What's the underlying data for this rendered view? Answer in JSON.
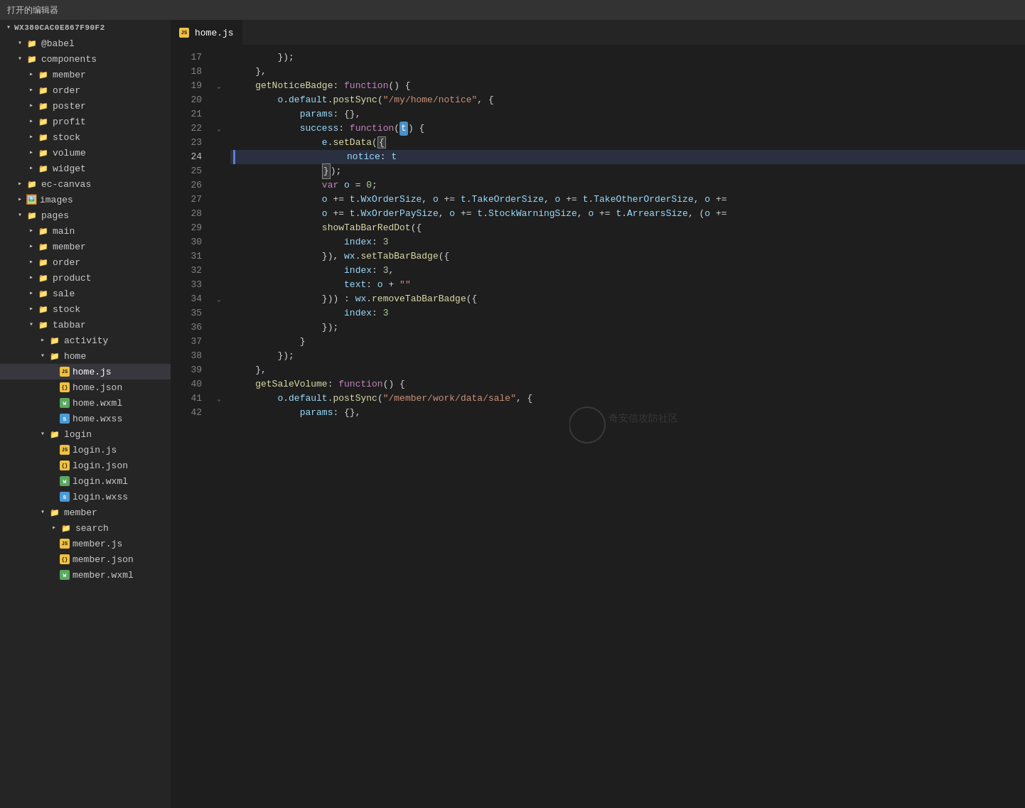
{
  "titleBar": {
    "label": "打开的编辑器"
  },
  "sidebar": {
    "rootLabel": "WX380CAC0E867F90F2",
    "items": [
      {
        "id": "babel",
        "label": "@babel",
        "type": "folder",
        "indent": 1,
        "open": true
      },
      {
        "id": "components",
        "label": "components",
        "type": "folder",
        "indent": 1,
        "open": true
      },
      {
        "id": "member-folder",
        "label": "member",
        "type": "folder",
        "indent": 2,
        "open": false
      },
      {
        "id": "order-folder",
        "label": "order",
        "type": "folder",
        "indent": 2,
        "open": false
      },
      {
        "id": "poster",
        "label": "poster",
        "type": "folder",
        "indent": 2,
        "open": false
      },
      {
        "id": "profit",
        "label": "profit",
        "type": "folder",
        "indent": 2,
        "open": false
      },
      {
        "id": "stock",
        "label": "stock",
        "type": "folder",
        "indent": 2,
        "open": false
      },
      {
        "id": "volume",
        "label": "volume",
        "type": "folder",
        "indent": 2,
        "open": false
      },
      {
        "id": "widget",
        "label": "widget",
        "type": "folder",
        "indent": 2,
        "open": false
      },
      {
        "id": "ec-canvas",
        "label": "ec-canvas",
        "type": "folder",
        "indent": 1,
        "open": false
      },
      {
        "id": "images",
        "label": "images",
        "type": "folder-img",
        "indent": 1,
        "open": false
      },
      {
        "id": "pages",
        "label": "pages",
        "type": "folder",
        "indent": 1,
        "open": true
      },
      {
        "id": "main-folder",
        "label": "main",
        "type": "folder",
        "indent": 2,
        "open": false
      },
      {
        "id": "member-pages",
        "label": "member",
        "type": "folder",
        "indent": 2,
        "open": false
      },
      {
        "id": "order-pages",
        "label": "order",
        "type": "folder",
        "indent": 2,
        "open": false
      },
      {
        "id": "product",
        "label": "product",
        "type": "folder",
        "indent": 2,
        "open": false
      },
      {
        "id": "sale",
        "label": "sale",
        "type": "folder",
        "indent": 2,
        "open": false
      },
      {
        "id": "stock-pages",
        "label": "stock",
        "type": "folder",
        "indent": 2,
        "open": false
      },
      {
        "id": "tabbar",
        "label": "tabbar",
        "type": "folder",
        "indent": 2,
        "open": true
      },
      {
        "id": "activity",
        "label": "activity",
        "type": "folder",
        "indent": 3,
        "open": false
      },
      {
        "id": "home-folder",
        "label": "home",
        "type": "folder",
        "indent": 3,
        "open": true
      },
      {
        "id": "home-js",
        "label": "home.js",
        "type": "js",
        "indent": 4,
        "active": true
      },
      {
        "id": "home-json",
        "label": "home.json",
        "type": "json",
        "indent": 4
      },
      {
        "id": "home-wxml",
        "label": "home.wxml",
        "type": "wxml",
        "indent": 4
      },
      {
        "id": "home-wxss",
        "label": "home.wxss",
        "type": "wxss",
        "indent": 4
      },
      {
        "id": "login-folder",
        "label": "login",
        "type": "folder",
        "indent": 3,
        "open": true
      },
      {
        "id": "login-js",
        "label": "login.js",
        "type": "js",
        "indent": 4
      },
      {
        "id": "login-json",
        "label": "login.json",
        "type": "json",
        "indent": 4
      },
      {
        "id": "login-wxml",
        "label": "login.wxml",
        "type": "wxml",
        "indent": 4
      },
      {
        "id": "login-wxss",
        "label": "login.wxss",
        "type": "wxss",
        "indent": 4
      },
      {
        "id": "member-tabbar",
        "label": "member",
        "type": "folder",
        "indent": 3,
        "open": false
      },
      {
        "id": "search-folder",
        "label": "search",
        "type": "folder",
        "indent": 4,
        "open": false
      },
      {
        "id": "member-js",
        "label": "member.js",
        "type": "js",
        "indent": 4
      },
      {
        "id": "member-json",
        "label": "member.json",
        "type": "json",
        "indent": 4
      },
      {
        "id": "member-wxml",
        "label": "member.wxml",
        "type": "wxml",
        "indent": 4
      }
    ]
  },
  "editor": {
    "filename": "home.js",
    "lines": [
      {
        "num": 17,
        "fold": false,
        "content": "        });"
      },
      {
        "num": 18,
        "fold": false,
        "content": "    },"
      },
      {
        "num": 19,
        "fold": true,
        "content": "    getNoticeBadge: function() {"
      },
      {
        "num": 20,
        "fold": false,
        "content": "        o.default.postSync(\"/my/home/notice\", {"
      },
      {
        "num": 21,
        "fold": false,
        "content": "            params: {},"
      },
      {
        "num": 22,
        "fold": true,
        "content": "            success: function(t) {"
      },
      {
        "num": 23,
        "fold": false,
        "content": "                e.setData({"
      },
      {
        "num": 24,
        "fold": false,
        "content": "                    notice: t",
        "highlight": true
      },
      {
        "num": 25,
        "fold": false,
        "content": "                });"
      },
      {
        "num": 26,
        "fold": false,
        "content": "                var o = 0;"
      },
      {
        "num": 27,
        "fold": false,
        "content": "                o += t.WxOrderSize, o += t.TakeOrderSize, o += t.TakeOtherOrderSize, o +="
      },
      {
        "num": 28,
        "fold": false,
        "content": "                o += t.WxOrderPaySize, o += t.StockWarningSize, o += t.ArrearsSize, (o +="
      },
      {
        "num": 29,
        "fold": false,
        "content": "                showTabBarRedDot({"
      },
      {
        "num": 30,
        "fold": false,
        "content": "                    index: 3"
      },
      {
        "num": 31,
        "fold": false,
        "content": "                }), wx.setTabBarBadge({"
      },
      {
        "num": 32,
        "fold": false,
        "content": "                    index: 3,"
      },
      {
        "num": 33,
        "fold": false,
        "content": "                    text: o + \"\""
      },
      {
        "num": 34,
        "fold": true,
        "content": "                })) : wx.removeTabBarBadge({"
      },
      {
        "num": 35,
        "fold": false,
        "content": "                    index: 3"
      },
      {
        "num": 36,
        "fold": false,
        "content": "                });"
      },
      {
        "num": 37,
        "fold": false,
        "content": "            }"
      },
      {
        "num": 38,
        "fold": false,
        "content": "        });"
      },
      {
        "num": 39,
        "fold": false,
        "content": "    },"
      },
      {
        "num": 40,
        "fold": false,
        "content": "    getSaleVolume: function() {"
      },
      {
        "num": 41,
        "fold": true,
        "content": "        o.default.postSync(\"/member/work/data/sale\", {"
      },
      {
        "num": 42,
        "fold": false,
        "content": "            params: {},"
      }
    ]
  }
}
